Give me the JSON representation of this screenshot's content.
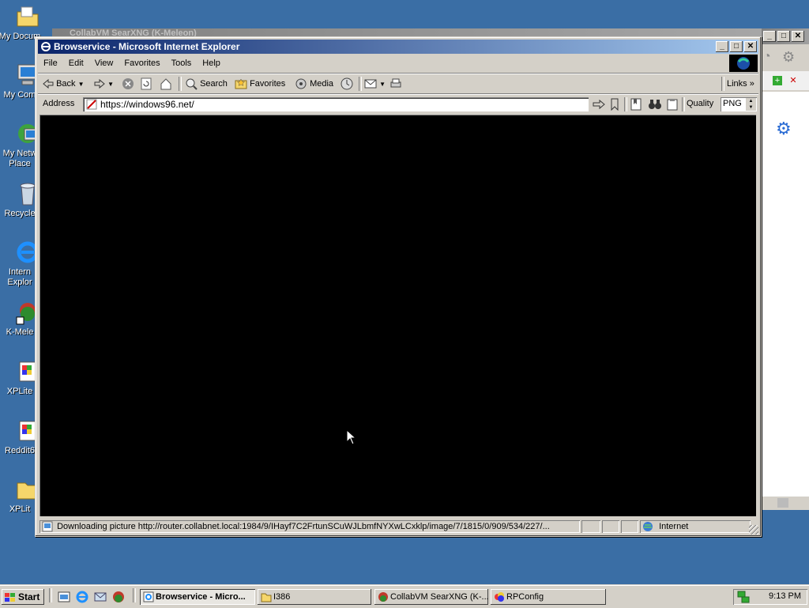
{
  "desktop": {
    "icons": [
      {
        "label": "My Docum",
        "icon": "folder-documents-icon"
      },
      {
        "label": "My Com",
        "icon": "computer-icon"
      },
      {
        "label": "My Netw\nPlace",
        "icon": "network-icon"
      },
      {
        "label": "Recycle",
        "icon": "recycle-bin-icon"
      },
      {
        "label": "Intern\nExplor",
        "icon": "internet-explorer-icon"
      },
      {
        "label": "K-Mele",
        "icon": "k-meleon-icon"
      },
      {
        "label": "XPLite",
        "icon": "xplite-icon"
      },
      {
        "label": "Reddit6",
        "icon": "reddit-icon"
      },
      {
        "label": "XPLit",
        "icon": "folder-icon"
      }
    ]
  },
  "behind_window": {
    "title": "CollabVM SearXNG (K-Meleon)"
  },
  "window": {
    "title": "Browservice - Microsoft Internet Explorer",
    "menu": [
      "File",
      "Edit",
      "View",
      "Favorites",
      "Tools",
      "Help"
    ],
    "toolbar": {
      "back": "Back",
      "search": "Search",
      "favorites": "Favorites",
      "media": "Media",
      "links": "Links"
    },
    "address": {
      "label": "Address",
      "url": "https://windows96.net/"
    },
    "quality": {
      "label": "Quality",
      "value": "PNG"
    },
    "status": {
      "text": "Downloading picture http://router.collabnet.local:1984/9/IHayf7C2FrtunSCuWJLbmfNYXwLCxklp/image/7/1815/0/909/534/227/...",
      "zone": "Internet"
    }
  },
  "taskbar": {
    "start": "Start",
    "items": [
      {
        "label": "Browservice - Micro...",
        "active": true
      },
      {
        "label": "I386",
        "active": false
      },
      {
        "label": "CollabVM SearXNG (K-...",
        "active": false
      },
      {
        "label": "RPConfig",
        "active": false
      }
    ],
    "clock": "9:13 PM"
  },
  "colors": {
    "desktop": "#3a6ea5",
    "titlebar_start": "#0a246a",
    "titlebar_end": "#a6caf0",
    "chrome": "#d4d0c8",
    "viewport": "#000000"
  }
}
